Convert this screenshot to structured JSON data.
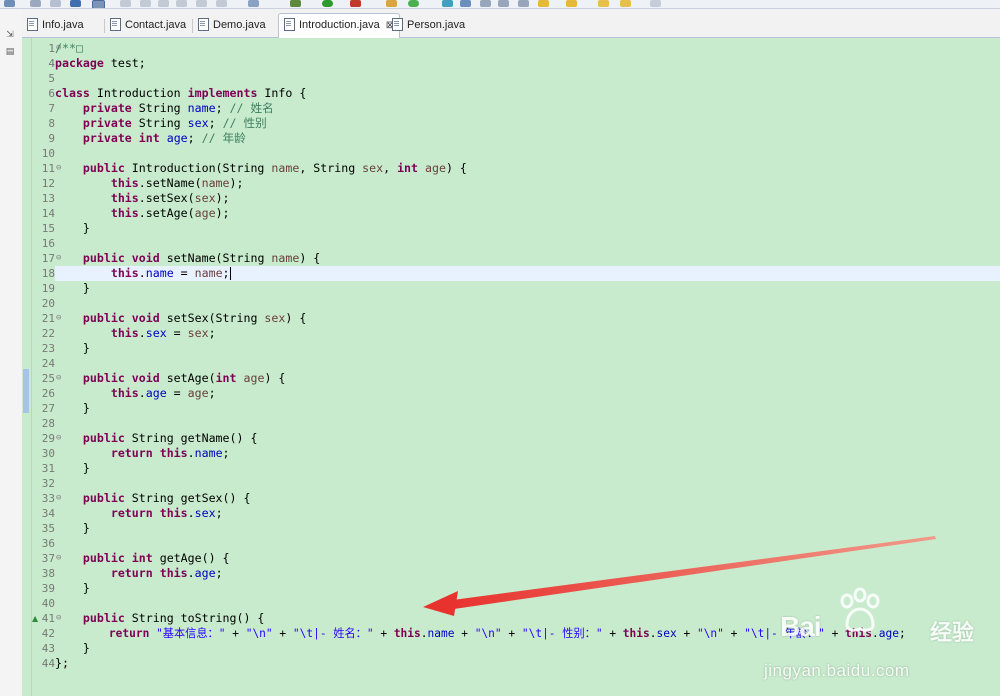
{
  "tabs": [
    {
      "label": "Info.java",
      "active": false
    },
    {
      "label": "Contact.java",
      "active": false
    },
    {
      "label": "Demo.java",
      "active": false
    },
    {
      "label": "Introduction.java",
      "active": true,
      "close": "⊠"
    },
    {
      "label": "Person.java",
      "active": false
    }
  ],
  "line_numbers": [
    "1",
    "4",
    "5",
    "6",
    "7",
    "8",
    "9",
    "10",
    "11",
    "12",
    "13",
    "14",
    "15",
    "16",
    "17",
    "18",
    "19",
    "20",
    "21",
    "22",
    "23",
    "24",
    "25",
    "26",
    "27",
    "28",
    "29",
    "30",
    "31",
    "32",
    "33",
    "34",
    "35",
    "36",
    "37",
    "38",
    "39",
    "40",
    "41",
    "42",
    "43",
    "44"
  ],
  "fold_markers": {
    "1": "⊕",
    "11": "⊖",
    "17": "⊖",
    "21": "⊖",
    "25": "⊖",
    "29": "⊖",
    "33": "⊖",
    "37": "⊖",
    "41": "⊖"
  },
  "current_line": "18",
  "code": {
    "l1": {
      "t1": "/**",
      "t2": "□"
    },
    "l4": {
      "t1": "package",
      "t2": " test;"
    },
    "l6": {
      "t1": "class",
      "t2": " Introduction ",
      "t3": "implements",
      "t4": " Info {"
    },
    "l7": {
      "t1": "    ",
      "t2": "private",
      "t3": " String ",
      "t4": "name",
      "t5": "; ",
      "t6": "// 姓名"
    },
    "l8": {
      "t1": "    ",
      "t2": "private",
      "t3": " String ",
      "t4": "sex",
      "t5": "; ",
      "t6": "// 性别"
    },
    "l9": {
      "t1": "    ",
      "t2": "private",
      "t3": " ",
      "t4": "int",
      "t5": " ",
      "t6": "age",
      "t7": "; ",
      "t8": "// 年龄"
    },
    "l11": {
      "t1": "    ",
      "t2": "public",
      "t3": " Introduction(String ",
      "t4": "name",
      "t5": ", String ",
      "t6": "sex",
      "t7": ", ",
      "t8": "int",
      "t9": " ",
      "t10": "age",
      "t11": ") {"
    },
    "l12": {
      "t1": "        ",
      "t2": "this",
      "t3": ".setName(",
      "t4": "name",
      "t5": ");"
    },
    "l13": {
      "t1": "        ",
      "t2": "this",
      "t3": ".setSex(",
      "t4": "sex",
      "t5": ");"
    },
    "l14": {
      "t1": "        ",
      "t2": "this",
      "t3": ".setAge(",
      "t4": "age",
      "t5": ");"
    },
    "l15": {
      "t1": "    }"
    },
    "l17": {
      "t1": "    ",
      "t2": "public",
      "t3": " ",
      "t4": "void",
      "t5": " setName(String ",
      "t6": "name",
      "t7": ") {"
    },
    "l18": {
      "t1": "        ",
      "t2": "this",
      "t3": ".",
      "t4": "name",
      "t5": " = ",
      "t6": "name",
      "t7": ";"
    },
    "l19": {
      "t1": "    }"
    },
    "l21": {
      "t1": "    ",
      "t2": "public",
      "t3": " ",
      "t4": "void",
      "t5": " setSex(String ",
      "t6": "sex",
      "t7": ") {"
    },
    "l22": {
      "t1": "        ",
      "t2": "this",
      "t3": ".",
      "t4": "sex",
      "t5": " = ",
      "t6": "sex",
      "t7": ";"
    },
    "l23": {
      "t1": "    }"
    },
    "l25": {
      "t1": "    ",
      "t2": "public",
      "t3": " ",
      "t4": "void",
      "t5": " setAge(",
      "t6": "int",
      "t7": " ",
      "t8": "age",
      "t9": ") {"
    },
    "l26": {
      "t1": "        ",
      "t2": "this",
      "t3": ".",
      "t4": "age",
      "t5": " = ",
      "t6": "age",
      "t7": ";"
    },
    "l27": {
      "t1": "    }"
    },
    "l29": {
      "t1": "    ",
      "t2": "public",
      "t3": " String getName() {"
    },
    "l30": {
      "t1": "        ",
      "t2": "return",
      "t3": " ",
      "t4": "this",
      "t5": ".",
      "t6": "name",
      "t7": ";"
    },
    "l31": {
      "t1": "    }"
    },
    "l33": {
      "t1": "    ",
      "t2": "public",
      "t3": " String getSex() {"
    },
    "l34": {
      "t1": "        ",
      "t2": "return",
      "t3": " ",
      "t4": "this",
      "t5": ".",
      "t6": "sex",
      "t7": ";"
    },
    "l35": {
      "t1": "    }"
    },
    "l37": {
      "t1": "    ",
      "t2": "public",
      "t3": " ",
      "t4": "int",
      "t5": " getAge() {"
    },
    "l38": {
      "t1": "        ",
      "t2": "return",
      "t3": " ",
      "t4": "this",
      "t5": ".",
      "t6": "age",
      "t7": ";"
    },
    "l39": {
      "t1": "    }"
    },
    "l41": {
      "t1": "    ",
      "t2": "public",
      "t3": " String toString() {"
    },
    "l42": {
      "t1": "        ",
      "t2": "return",
      "t3": " ",
      "t4": "\"基本信息：\"",
      "t5": " + ",
      "t6": "\"\\n\"",
      "t7": " + ",
      "t8": "\"\\t|- 姓名：\"",
      "t9": " + ",
      "t10": "this",
      "t11": ".",
      "t12": "name",
      "t13": " + ",
      "t14": "\"\\n\"",
      "t15": " + ",
      "t16": "\"\\t|- 性别：\"",
      "t17": " + ",
      "t18": "this",
      "t19": ".",
      "t20": "sex",
      "t21": " + ",
      "t22": "\"\\n\"",
      "t23": " + ",
      "t24": "\"\\t|- 年龄：\"",
      "t25": " + ",
      "t26": "this",
      "t27": ".",
      "t28": "age",
      "t29": ";"
    },
    "l43": {
      "t1": "    }"
    },
    "l44": {
      "t1": "};"
    }
  },
  "annotation": {
    "type": "red-arrow",
    "color": "#e8322e"
  },
  "watermark": {
    "brand": "Bai",
    "brand2": "经验",
    "url": "jingyan.baidu.com"
  },
  "colors": {
    "editor_bg": "#c7ebcc",
    "keyword": "#7f0055",
    "field": "#0000c0",
    "param": "#6a3e3e",
    "string": "#2a00ff",
    "comment": "#3f7f5f"
  }
}
